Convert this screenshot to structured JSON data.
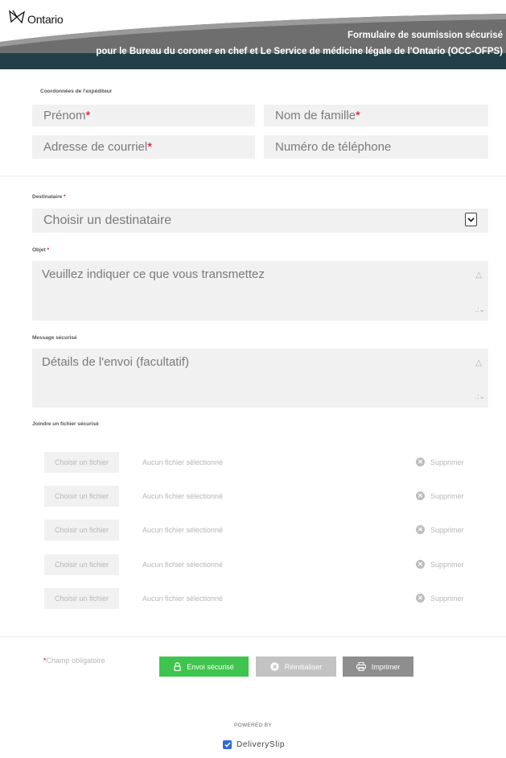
{
  "header": {
    "logo_text": "Ontario",
    "title": "Formulaire de soumission sécurisé",
    "subtitle": "pour le Bureau du coroner en chef et Le Service de médicine légale de l'Ontario (OCC-OFPS)"
  },
  "sender": {
    "section_label": "Coordonnées de l'expéditeur",
    "first_name": "Prénom",
    "last_name": "Nom de famille",
    "email": "Adresse de courriel",
    "phone": "Numéro de téléphone"
  },
  "recipient": {
    "label": "Destinataire",
    "selected": "Choisir un destinataire"
  },
  "subject": {
    "label": "Objet",
    "placeholder": "Veuillez indiquer ce que vous transmettez"
  },
  "message": {
    "label": "Message sécurisé",
    "placeholder": "Détails de l'envoi (facultatif)"
  },
  "attachments": {
    "label": "Joindre un fichier sécurisé",
    "rows": [
      {
        "button": "Choisir un fichier",
        "status": "Aucun fichier sélectionné",
        "remove": "Supprimer"
      },
      {
        "button": "Choisir un fichier",
        "status": "Aucun fichier sélectionné",
        "remove": "Supprimer"
      },
      {
        "button": "Choisir un fichier",
        "status": "Aucun fichier sélectionné",
        "remove": "Supprimer"
      },
      {
        "button": "Choisir un fichier",
        "status": "Aucun fichier sélectionné",
        "remove": "Supprimer"
      },
      {
        "button": "Choisir un fichier",
        "status": "Aucun fichier sélectionné",
        "remove": "Supprimer"
      }
    ]
  },
  "footer": {
    "required_star": "*",
    "required_note": "Champ obligatoire",
    "send_label": "Envoi sécurisé",
    "reset_label": "Réinitialiser",
    "print_label": "Imprimer",
    "powered_by": "POWERED BY",
    "brand": "DeliverySlip"
  },
  "colors": {
    "banner": "#6e6e6e",
    "banner_dark": "#1e3a45",
    "send": "#3fc44d",
    "reset": "#c3c3c3",
    "print": "#8e8e8e",
    "required": "#d0021b",
    "field_bg": "#f1f1f1"
  },
  "icons": {
    "logo": "trillium-logo-icon",
    "select": "chevron-down-icon",
    "remove": "x-circle-icon",
    "send": "lock-icon",
    "reset": "x-circle-icon",
    "print": "printer-icon",
    "brand": "deliveryslip-check-icon"
  }
}
